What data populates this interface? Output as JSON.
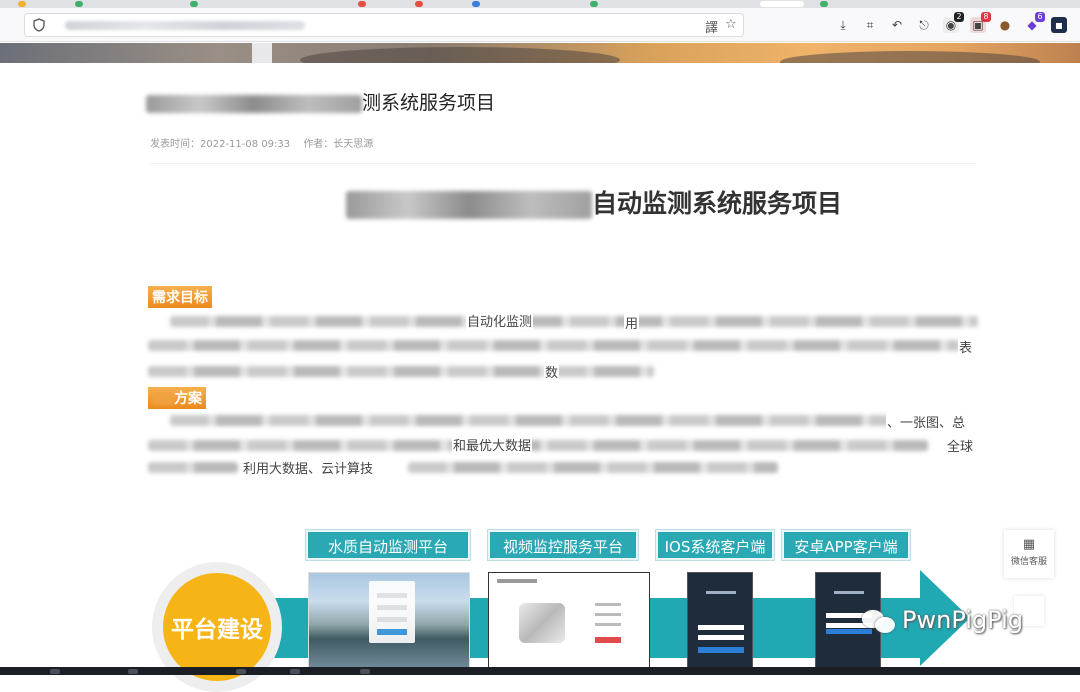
{
  "browser": {
    "url_text": "",
    "colors": {
      "toolbar": "#f9f9fb",
      "tabstrip": "#dfe1e5"
    },
    "toolbar_icons": [
      "translate-icon",
      "star-icon",
      "download-icon",
      "crop-icon",
      "undo-icon",
      "share-icon"
    ],
    "extensions": [
      {
        "name": "extension-a-icon",
        "badge": "2",
        "badge_color": "#222222"
      },
      {
        "name": "extension-b-icon",
        "badge": "8",
        "badge_color": "#d9363e"
      },
      {
        "name": "cookie-icon",
        "badge": ""
      },
      {
        "name": "extension-c-icon",
        "badge": "6",
        "badge_color": "#6b3fd6"
      },
      {
        "name": "extension-d-icon",
        "badge": ""
      }
    ]
  },
  "article": {
    "title_visible": "测系统服务项目",
    "meta": {
      "date_label": "发表时间：2022-11-08 09:33",
      "author_label": "作者：长天思源"
    },
    "headline_visible": "自动监测系统服务项目",
    "section1_title": "需求目标",
    "section2_title": "方案",
    "fragment_1": "自动化监测",
    "fragment_2": "用",
    "fragment_3": "表",
    "fragment_4": "数",
    "fragment_5": "、一张图、总",
    "fragment_6": "和最优大数据",
    "fragment_7": "全球",
    "fragment_8": "利用大数据、云计算技"
  },
  "infographic": {
    "center_label": "平台建设",
    "platforms": [
      {
        "label": "水质自动监测平台"
      },
      {
        "label": "视频监控服务平台"
      },
      {
        "label": "IOS系统客户端"
      },
      {
        "label": "安卓APP客户端"
      }
    ],
    "colors": {
      "teal": "#20a9b3",
      "gold": "#f6b416"
    }
  },
  "widgets": {
    "service_label": "微信客服",
    "watermark": "PwnPigPig"
  }
}
